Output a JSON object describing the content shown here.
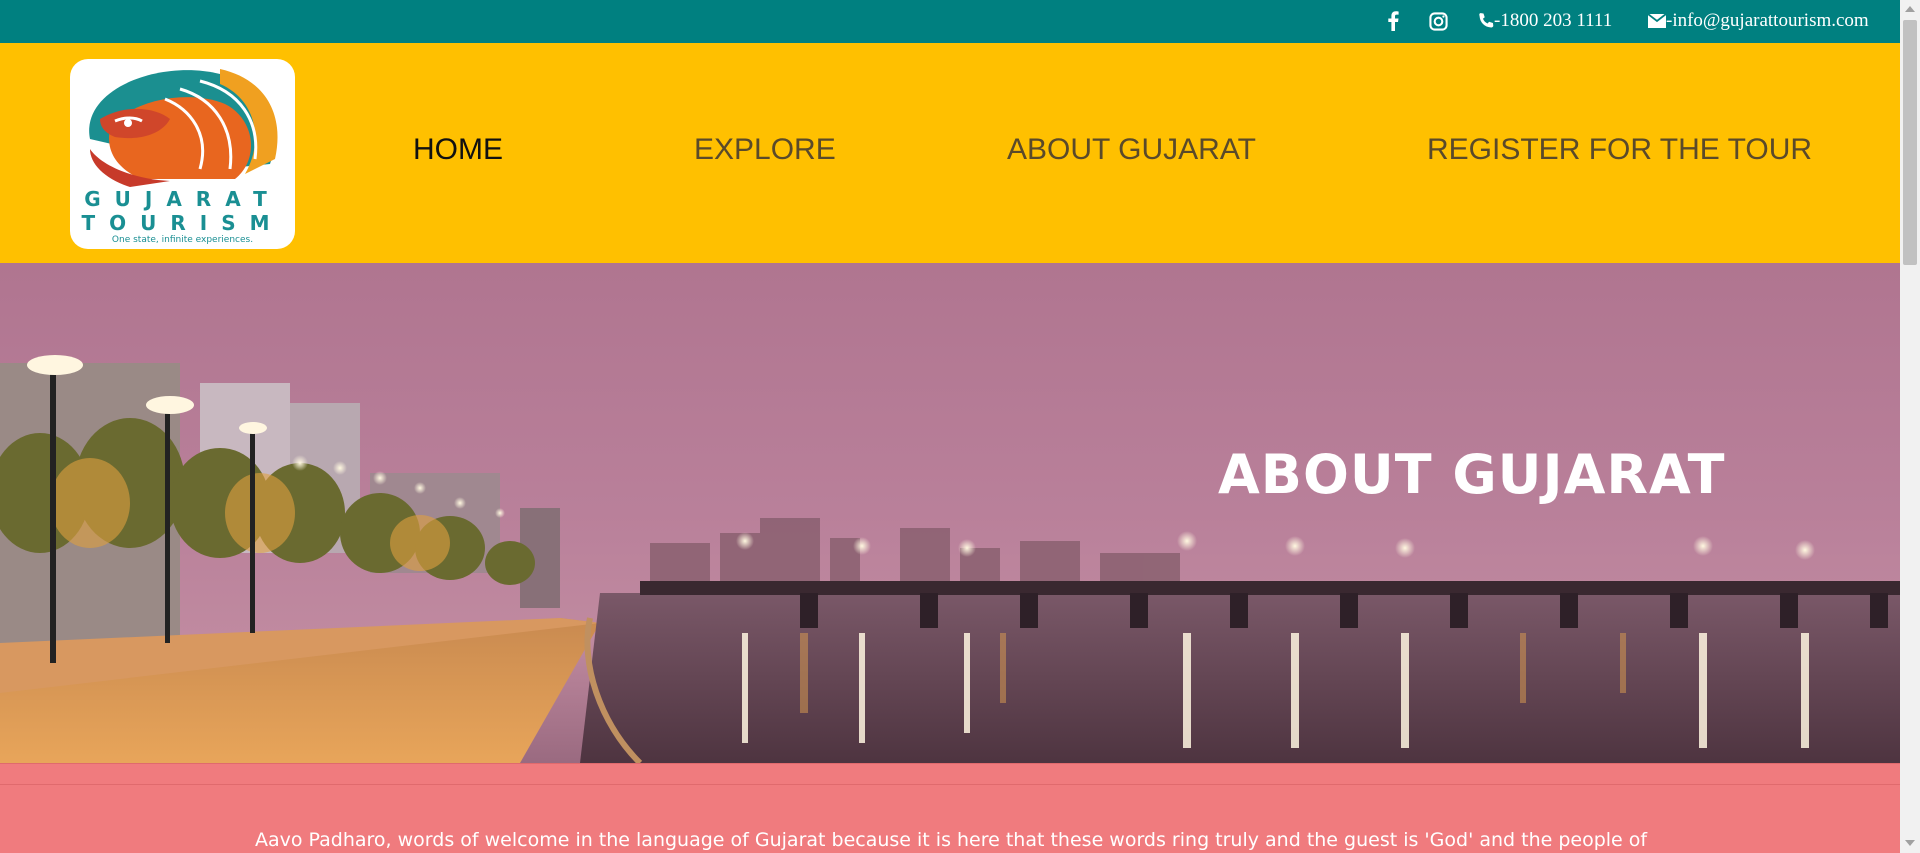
{
  "topbar": {
    "facebook_icon": "facebook-icon",
    "instagram_icon": "instagram-icon",
    "phone": "-1800 203 1111",
    "email": "-info@gujarattourism.com"
  },
  "logo": {
    "word1": "GUJARAT",
    "word2": "TOURISM",
    "tagline": "One state, infinite experiences."
  },
  "nav": {
    "items": [
      {
        "label": "HOME"
      },
      {
        "label": "EXPLORE"
      },
      {
        "label": "ABOUT GUJARAT"
      },
      {
        "label": "REGISTER FOR THE TOUR"
      }
    ],
    "active": "HOME"
  },
  "hero": {
    "title": "ABOUT GUJARAT"
  },
  "content": {
    "intro": "Aavo Padharo, words of welcome in the language of Gujarat because it is here that these words ring truly and the guest is 'God' and the people of Gujarat are gregariously friendly, inviting and will entice you to come again and again."
  },
  "colors": {
    "topbar": "#008080",
    "header": "#ffc000",
    "content": "#f07b7e"
  }
}
